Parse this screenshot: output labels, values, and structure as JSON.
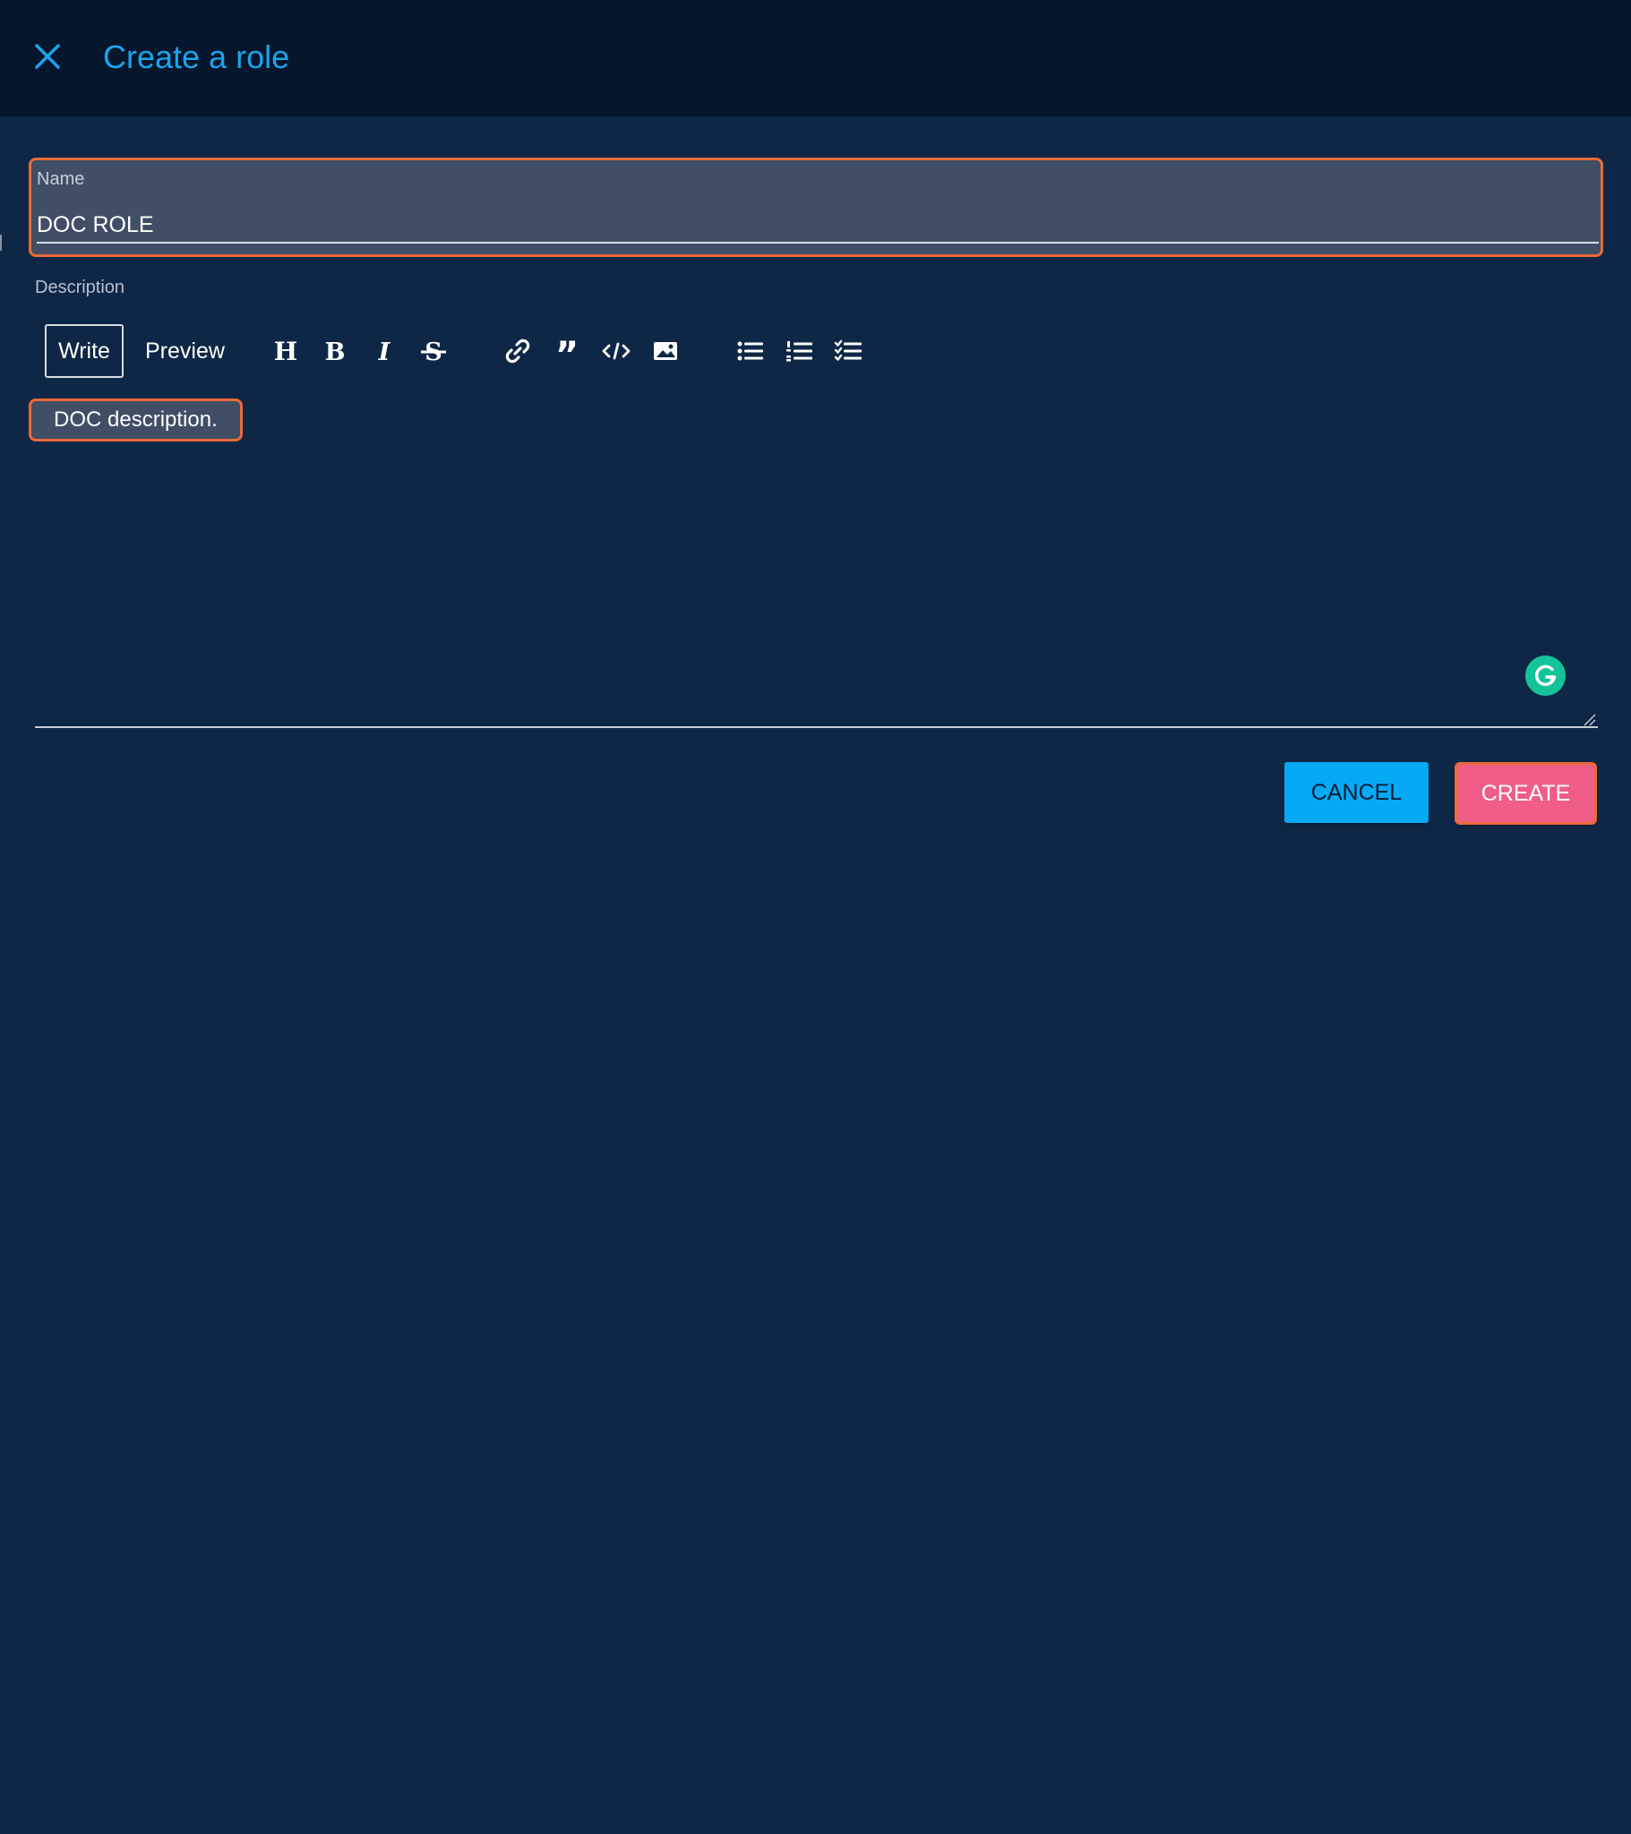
{
  "header": {
    "title": "Create a role",
    "close_icon": "close-icon"
  },
  "name_field": {
    "label": "Name",
    "value": "DOC ROLE"
  },
  "description": {
    "label": "Description",
    "tabs": {
      "write": "Write",
      "preview": "Preview"
    },
    "active_tab": "Write",
    "toolbar_icons": [
      "heading-icon",
      "bold-icon",
      "italic-icon",
      "strikethrough-icon",
      "link-icon",
      "quote-icon",
      "code-icon",
      "image-icon",
      "bulleted-list-icon",
      "numbered-list-icon",
      "checked-list-icon"
    ],
    "value": "DOC description."
  },
  "actions": {
    "cancel_label": "CANCEL",
    "create_label": "CREATE"
  },
  "colors": {
    "background": "#0f2746",
    "header_background": "#06162c",
    "accent": "#1ba4ea",
    "cancel_button": "#05a9f4",
    "create_button": "#f05d86",
    "highlight_outline": "#ea6a3a",
    "grammarly": "#15c39a"
  }
}
